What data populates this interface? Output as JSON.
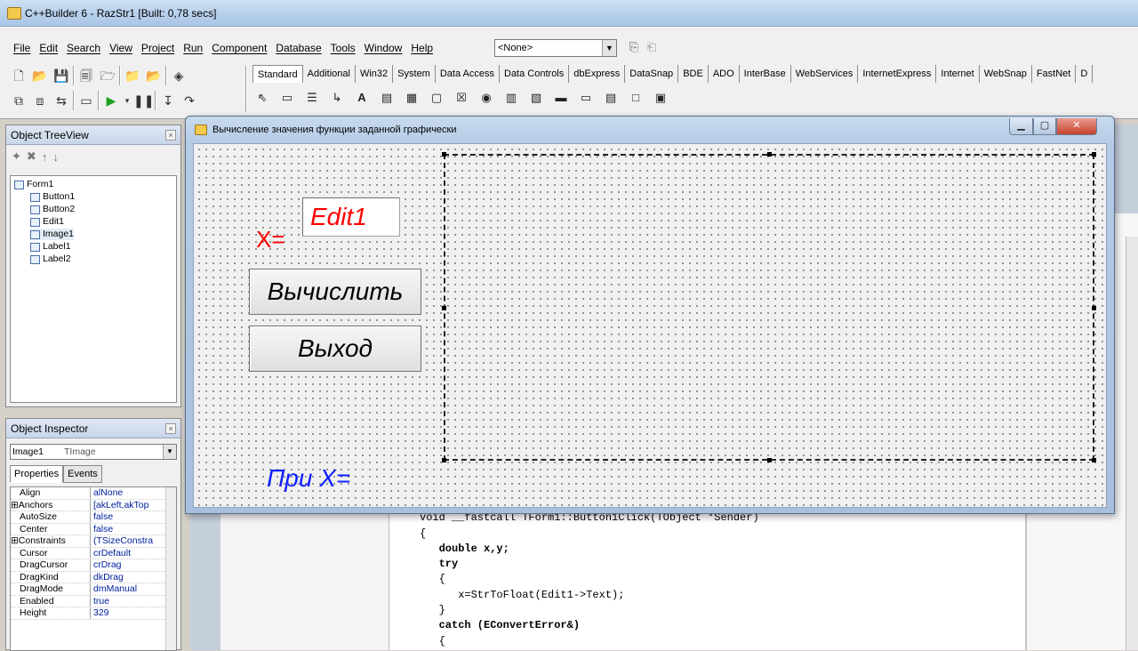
{
  "ide": {
    "title": "C++Builder 6 - RazStr1 [Built: 0,78 secs]",
    "menu": [
      "File",
      "Edit",
      "Search",
      "View",
      "Project",
      "Run",
      "Component",
      "Database",
      "Tools",
      "Window",
      "Help"
    ],
    "config_combo": "<None>",
    "palette_tabs": [
      "Standard",
      "Additional",
      "Win32",
      "System",
      "Data Access",
      "Data Controls",
      "dbExpress",
      "DataSnap",
      "BDE",
      "ADO",
      "InterBase",
      "WebServices",
      "InternetExpress",
      "Internet",
      "WebSnap",
      "FastNet",
      "D"
    ],
    "active_palette_tab": "Standard"
  },
  "tree_view": {
    "caption": "Object TreeView",
    "root": "Form1",
    "children": [
      "Button1",
      "Button2",
      "Edit1",
      "Image1",
      "Label1",
      "Label2"
    ]
  },
  "inspector": {
    "caption": "Object Inspector",
    "selected_name": "Image1",
    "selected_type": "TImage",
    "tab_properties": "Properties",
    "tab_events": "Events",
    "rows": [
      {
        "name": "Align",
        "value": "alNone",
        "expandable": false
      },
      {
        "name": "⊞Anchors",
        "value": "[akLeft,akTop",
        "expandable": true
      },
      {
        "name": "AutoSize",
        "value": "false",
        "expandable": false
      },
      {
        "name": "Center",
        "value": "false",
        "expandable": false
      },
      {
        "name": "⊞Constraints",
        "value": "(TSizeConstra",
        "expandable": true
      },
      {
        "name": "Cursor",
        "value": "crDefault",
        "expandable": false
      },
      {
        "name": "DragCursor",
        "value": "crDrag",
        "expandable": false
      },
      {
        "name": "DragKind",
        "value": "dkDrag",
        "expandable": false
      },
      {
        "name": "DragMode",
        "value": "dmManual",
        "expandable": false
      },
      {
        "name": "Enabled",
        "value": "true",
        "expandable": false
      },
      {
        "name": "Height",
        "value": "329",
        "expandable": false
      }
    ]
  },
  "form": {
    "title": "Вычисление значения функции заданной графически",
    "label_x": "X=",
    "edit1_text": "Edit1",
    "button_calc": "Вычислить",
    "button_exit": "Выход",
    "label_result": "При X="
  },
  "code": {
    "lines": [
      "void __fastcall TForm1::Button1Click(TObject *Sender)",
      "{",
      "   double x,y;",
      "   try",
      "   {",
      "      x=StrToFloat(Edit1->Text);",
      "   }",
      "   catch (EConvertError&)",
      "   {"
    ]
  },
  "colors": {
    "label_x": "#ff0000",
    "edit1_text": "#ff0000",
    "label_result": "#1020ff"
  }
}
